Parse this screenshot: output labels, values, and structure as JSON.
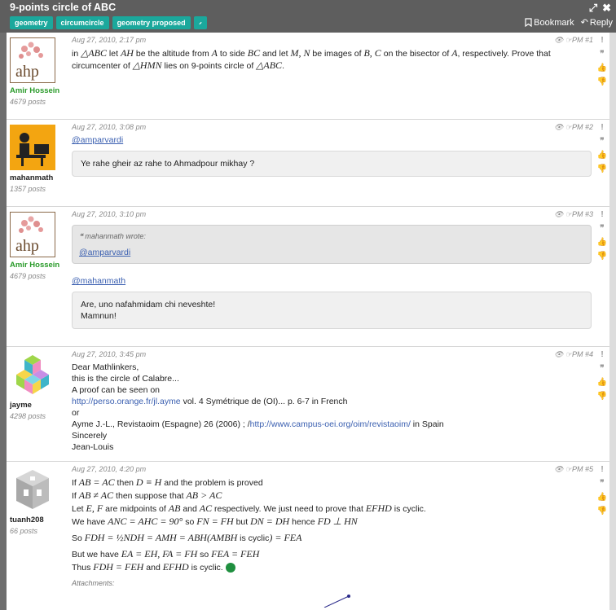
{
  "header": {
    "title": "9-points circle of ABC",
    "tags": [
      "geometry",
      "circumcircle",
      "geometry proposed"
    ],
    "bookmark_label": "Bookmark",
    "reply_label": "Reply"
  },
  "posts": [
    {
      "user": "Amir Hossein",
      "posts": "4679 posts",
      "date": "Aug 27, 2010, 2:17 pm",
      "num": "PM #1",
      "text_a": "in ",
      "m1": "△ABC",
      "text_b": " let ",
      "m2": "AH",
      "text_c": " be the altitude from ",
      "m3": "A",
      "text_d": " to side ",
      "m4": "BC",
      "text_e": " and let ",
      "m5": "M, N",
      "text_f": " be images of ",
      "m6": "B, C",
      "text_g": " on the bisector of ",
      "m7": "A",
      "text_h": ", respectively. Prove that circumcenter of ",
      "m8": "△HMN",
      "text_i": " lies on 9-points circle of ",
      "m9": "△ABC",
      "text_j": "."
    },
    {
      "user": "mahanmath",
      "posts": "1357 posts",
      "date": "Aug 27, 2010, 3:08 pm",
      "num": "PM #2",
      "mention": "@amparvardi",
      "box": "Ye rahe gheir az rahe to Ahmadpour mikhay ?"
    },
    {
      "user": "Amir Hossein",
      "posts": "4679 posts",
      "date": "Aug 27, 2010, 3:10 pm",
      "num": "PM #3",
      "quote_head": "mahanmath wrote:",
      "quote_mention": "@amparvardi",
      "mention": "@mahanmath",
      "box_l1": "Are, uno nafahmidam chi neveshte!",
      "box_l2": "Mamnun!"
    },
    {
      "user": "jayme",
      "posts": "4298 posts",
      "date": "Aug 27, 2010, 3:45 pm",
      "num": "PM #4",
      "l1": "Dear Mathlinkers,",
      "l2": "this is the circle of Calabre...",
      "l3": "A proof can be seen on",
      "l4_link": "http://perso.orange.fr/jl.ayme",
      "l4_rest": " vol. 4 Symétrique de (OI)... p. 6-7 in French",
      "l5": "or",
      "l6_a": "Ayme J.-L., Revistaoim (Espagne) 26 (2006) ; /",
      "l6_link": "http://www.campus-oei.org/oim/revistaoim/",
      "l6_b": " in Spain",
      "l7": "Sincerely",
      "l8": "Jean-Louis"
    },
    {
      "user": "tuanh208",
      "posts": "66 posts",
      "date": "Aug 27, 2010, 4:20 pm",
      "num": "PM #5",
      "l1_a": "If ",
      "l1_m1": "AB = AC",
      "l1_b": " then ",
      "l1_m2": "D ≡ H",
      "l1_c": " and the problem is proved",
      "l2_a": "If ",
      "l2_m1": "AB ≠ AC",
      "l2_b": " then suppose that ",
      "l2_m2": "AB > AC",
      "l3_a": "Let ",
      "l3_m1": "E, F",
      "l3_b": " are midpoints of ",
      "l3_m2": "AB",
      "l3_c": " and ",
      "l3_m3": "AC",
      "l3_d": " respectively. We just need to prove that ",
      "l3_m4": "EFHD",
      "l3_e": " is cyclic.",
      "l4_a": "We have ",
      "l4_m1": "ANC = AHC = 90°",
      "l4_b": " so ",
      "l4_m2": "FN = FH",
      "l4_c": " but ",
      "l4_m3": "DN = DH",
      "l4_d": " hence ",
      "l4_m4": "FD ⊥ HN",
      "l5_a": "So ",
      "l5_m1": "FDH = ½NDH = AMH = ABH(AMBH",
      "l5_b": " is cyclic",
      "l5_m2": ") = FEA",
      "l6_a": "But we have ",
      "l6_m1": "EA = EH, FA = FH",
      "l6_b": " so ",
      "l6_m2": "FEA = FEH",
      "l7_a": "Thus ",
      "l7_m1": "FDH = FEH",
      "l7_b": " and ",
      "l7_m2": "EFHD",
      "l7_c": " is cyclic.",
      "attach": "Attachments:"
    }
  ]
}
